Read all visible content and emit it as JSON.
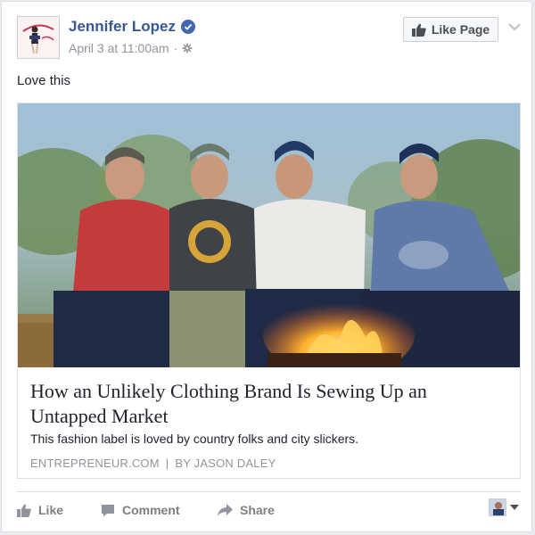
{
  "post": {
    "author": "Jennifer Lopez",
    "timestamp": "April 3 at 11:00am",
    "meta_separator": "·",
    "privacy_icon": "gear-icon",
    "like_page_label": "Like Page",
    "text": "Love this"
  },
  "link": {
    "headline": "How an Unlikely Clothing Brand Is Sewing Up an Untapped Market",
    "description": "This fashion label is loved by country folks and city slickers.",
    "source": "ENTREPRENEUR.COM",
    "separator": "|",
    "byline": "BY JASON DALEY"
  },
  "actions": {
    "like": "Like",
    "comment": "Comment",
    "share": "Share"
  },
  "colors": {
    "brand_blue": "#365899",
    "verified": "#4267b2",
    "meta_gray": "#90949c",
    "action_gray": "#7f7f7f"
  }
}
